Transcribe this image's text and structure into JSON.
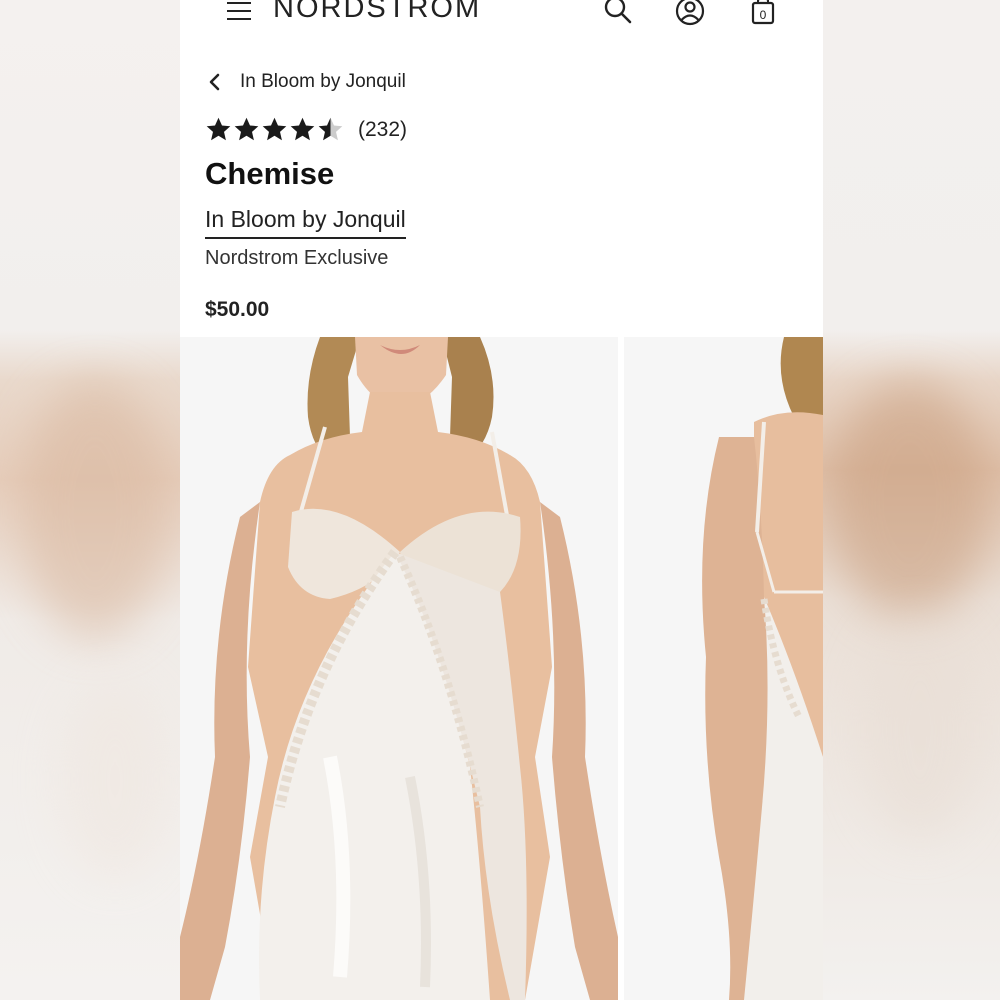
{
  "header": {
    "brand": "NORDSTROM",
    "icons": [
      "menu-icon",
      "search-icon",
      "account-icon",
      "bag-icon"
    ],
    "bag_count": "0"
  },
  "breadcrumb": {
    "back_label": "In Bloom by Jonquil"
  },
  "product": {
    "rating": 4.5,
    "review_count": "(232)",
    "title": "Chemise",
    "brand": "In Bloom by Jonquil",
    "exclusive_label": "Nordstrom Exclusive",
    "price": "$50.00"
  },
  "gallery": {
    "images": [
      "front-view",
      "back-view"
    ]
  },
  "colors": {
    "text": "#222222",
    "star": "#1a1a1a",
    "star_empty": "#cccccc",
    "background": "#ffffff"
  }
}
